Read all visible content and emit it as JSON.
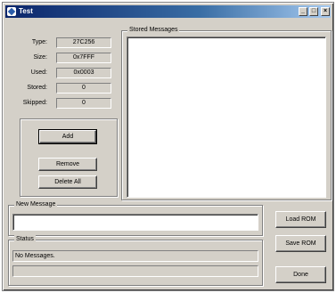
{
  "window": {
    "title": "Test",
    "controls": {
      "minimize": "_",
      "maximize": "□",
      "close": "×"
    }
  },
  "info": {
    "rows": [
      {
        "label": "Type:",
        "value": "27C256"
      },
      {
        "label": "Size:",
        "value": "0x7FFF"
      },
      {
        "label": "Used:",
        "value": "0x0003"
      },
      {
        "label": "Stored:",
        "value": "0"
      },
      {
        "label": "Skipped:",
        "value": "0"
      }
    ]
  },
  "buttons": {
    "add": "Add",
    "remove": "Remove",
    "delete_all": "Delete All",
    "load_rom": "Load ROM",
    "save_rom": "Save ROM",
    "done": "Done"
  },
  "stored_messages": {
    "label": "Stored Messages"
  },
  "new_message": {
    "label": "New Message",
    "value": ""
  },
  "status": {
    "label": "Status",
    "line1": "No Messages.",
    "line2": ""
  }
}
